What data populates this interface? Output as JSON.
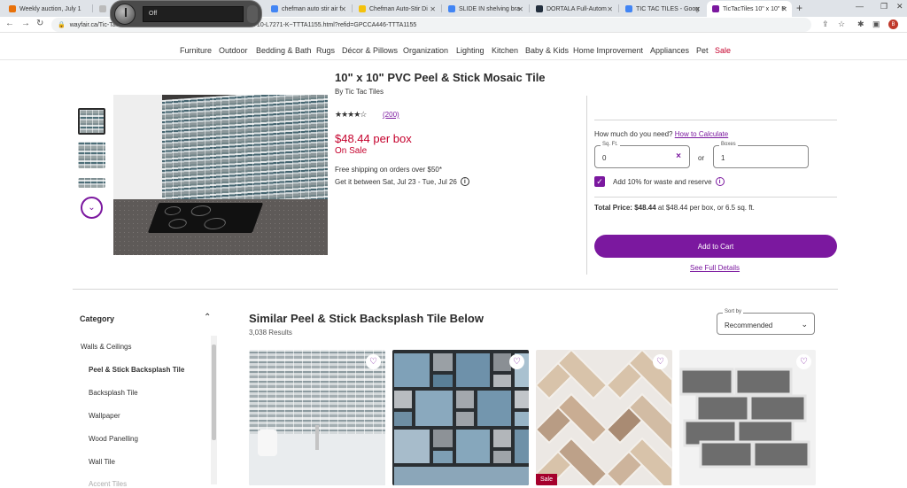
{
  "browser": {
    "tabs": [
      {
        "label": "Weekly auction, July 1",
        "color": "#e8710a"
      },
      {
        "label": "",
        "color": "#bbbbbb"
      },
      {
        "label": "chefman auto stir air f",
        "color": "#4285f4"
      },
      {
        "label": "Chefman Auto-Stir Di",
        "color": "#f4c20d"
      },
      {
        "label": "SLIDE IN shelving bra",
        "color": "#4285f4"
      },
      {
        "label": "DORTALA Full-Autom",
        "color": "#232f3e"
      },
      {
        "label": "TIC TAC TILES - Goog",
        "color": "#4285f4"
      },
      {
        "label": "TicTacTiles 10\" x 10\" P",
        "color": "#7b189f"
      }
    ],
    "url": "wayfair.ca/Tic-Tac-Tiles-10-x-10-PVC-Peel-Stick-Mosaic-Tile-BRS0710-L7271-K~TTTA1155.html?refid=GPCCA446-TTTA1155",
    "new_tab": "+",
    "media_status": "Off",
    "avatar_initial": "B"
  },
  "categories": [
    "Furniture",
    "Outdoor",
    "Bedding & Bath",
    "Rugs",
    "Décor & Pillows",
    "Organization",
    "Lighting",
    "Kitchen",
    "Baby & Kids",
    "Home Improvement",
    "Appliances",
    "Pet",
    "Sale"
  ],
  "product": {
    "title": "10\" x 10\" PVC Peel & Stick Mosaic Tile",
    "brand": "By Tic Tac Tiles",
    "rating_stars": "★★★★☆",
    "rating": 4.5,
    "reviews": "(200)",
    "price": "$48.44 per box",
    "sale": "On Sale",
    "shipping": "Free shipping on orders over $50*",
    "delivery": "Get it between Sat, Jul 23 - Tue, Jul 26",
    "info_icon": "i"
  },
  "purchase": {
    "question": "How much do you need?",
    "calc_link": "How to Calculate",
    "sqft_label": "Sq. Ft.",
    "sqft_value": "0",
    "or": "or",
    "boxes_label": "Boxes",
    "boxes_value": "1",
    "waste_label": "Add 10% for waste and reserve",
    "total_label": "Total Price:",
    "total_value": "$48.44",
    "total_detail": "at $48.44 per box, or 6.5 sq. ft.",
    "cart_button": "Add to Cart",
    "details_link": "See Full Details"
  },
  "sidebar": {
    "heading": "Category",
    "items": [
      "Walls & Ceilings",
      "Peel & Stick Backsplash Tile",
      "Backsplash Tile",
      "Wallpaper",
      "Wood Panelling",
      "Wall Tile",
      "Accent Tiles"
    ]
  },
  "similar": {
    "heading": "Similar Peel & Stick Backsplash Tile Below",
    "results": "3,038 Results",
    "sort_label": "Sort by",
    "sort_value": "Recommended",
    "sale_badge": "Sale"
  }
}
